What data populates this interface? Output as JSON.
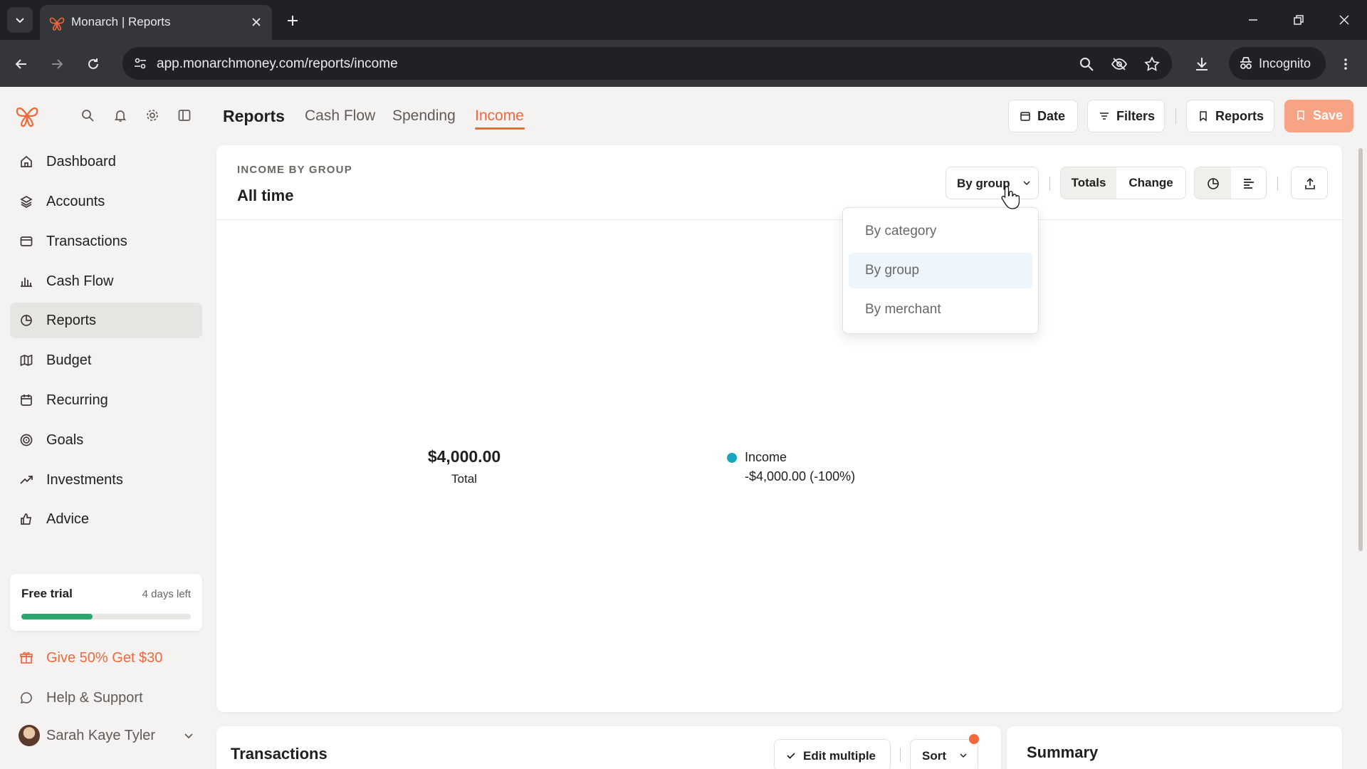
{
  "browser": {
    "tab_title": "Monarch | Reports",
    "url": "app.monarchmoney.com/reports/income",
    "profile_label": "Incognito"
  },
  "sidebar": {
    "items": [
      {
        "label": "Dashboard",
        "icon": "home-icon"
      },
      {
        "label": "Accounts",
        "icon": "layers-icon"
      },
      {
        "label": "Transactions",
        "icon": "credit-card-icon"
      },
      {
        "label": "Cash Flow",
        "icon": "bar-chart-icon"
      },
      {
        "label": "Reports",
        "icon": "pie-chart-icon",
        "active": true
      },
      {
        "label": "Budget",
        "icon": "map-icon"
      },
      {
        "label": "Recurring",
        "icon": "calendar-icon"
      },
      {
        "label": "Goals",
        "icon": "target-icon"
      },
      {
        "label": "Investments",
        "icon": "trend-up-icon"
      },
      {
        "label": "Advice",
        "icon": "thumbs-up-icon"
      }
    ],
    "trial": {
      "title": "Free trial",
      "days_left": "4 days left",
      "progress": 0.42
    },
    "referral_label": "Give 50% Get $30",
    "help_label": "Help & Support",
    "user_name": "Sarah Kaye Tyler"
  },
  "header": {
    "title": "Reports",
    "tabs": [
      {
        "label": "Cash Flow"
      },
      {
        "label": "Spending"
      },
      {
        "label": "Income",
        "active": true
      }
    ],
    "date_label": "Date",
    "filters_label": "Filters",
    "reports_label": "Reports",
    "save_label": "Save"
  },
  "report": {
    "kicker": "INCOME BY GROUP",
    "title": "All time",
    "group_by_label": "By group",
    "view_toggle": [
      "Totals",
      "Change"
    ],
    "active_view": "Totals",
    "dropdown_options": [
      {
        "label": "By category"
      },
      {
        "label": "By group",
        "selected": true
      },
      {
        "label": "By merchant"
      }
    ],
    "total_value": "$4,000.00",
    "total_label": "Total",
    "legend": [
      {
        "name": "Income",
        "value": "-$4,000.00 (-100%)",
        "color": "#19a6c2"
      }
    ]
  },
  "bottom": {
    "transactions_title": "Transactions",
    "edit_multiple_label": "Edit multiple",
    "sort_label": "Sort",
    "summary_title": "Summary"
  },
  "colors": {
    "accent": "#f0683c",
    "save_button": "#f6a386",
    "progress": "#2aa86b",
    "series_income": "#19a6c2"
  }
}
